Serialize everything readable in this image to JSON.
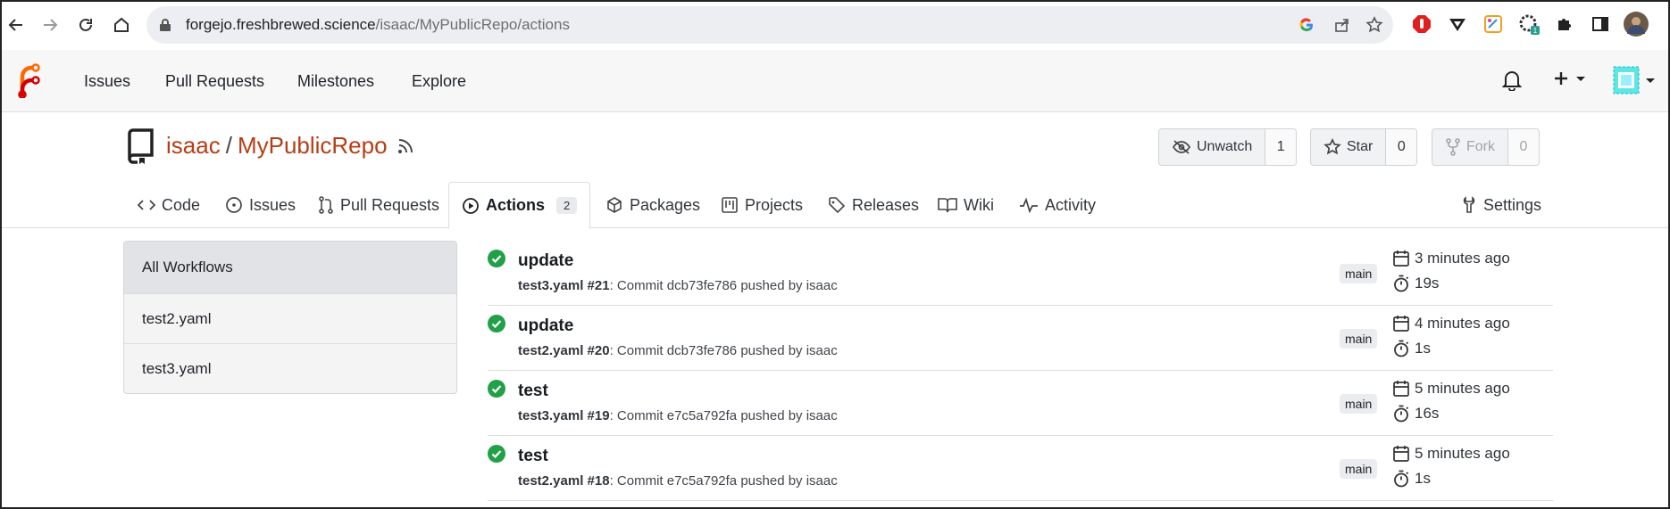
{
  "browser": {
    "url_host": "forgejo.freshbrewed.science",
    "url_path": "/isaac/MyPublicRepo/actions",
    "extension_badge": "1"
  },
  "topnav": {
    "items": [
      {
        "label": "Issues"
      },
      {
        "label": "Pull Requests"
      },
      {
        "label": "Milestones"
      },
      {
        "label": "Explore"
      }
    ]
  },
  "repo": {
    "owner": "isaac",
    "separator": "/",
    "name": "MyPublicRepo",
    "unwatch_label": "Unwatch",
    "watch_count": "1",
    "star_label": "Star",
    "star_count": "0",
    "fork_label": "Fork",
    "fork_count": "0"
  },
  "tabs": [
    {
      "label": "Code"
    },
    {
      "label": "Issues"
    },
    {
      "label": "Pull Requests"
    },
    {
      "label": "Actions",
      "badge": "2"
    },
    {
      "label": "Packages"
    },
    {
      "label": "Projects"
    },
    {
      "label": "Releases"
    },
    {
      "label": "Wiki"
    },
    {
      "label": "Activity"
    },
    {
      "label": "Settings"
    }
  ],
  "sidebar": {
    "items": [
      {
        "label": "All Workflows"
      },
      {
        "label": "test2.yaml"
      },
      {
        "label": "test3.yaml"
      }
    ]
  },
  "runs": [
    {
      "title": "update",
      "workflow": "test3.yaml #21",
      "detail": ": Commit dcb73fe786 pushed by isaac",
      "branch": "main",
      "when": "3 minutes ago",
      "duration": "19s"
    },
    {
      "title": "update",
      "workflow": "test2.yaml #20",
      "detail": ": Commit dcb73fe786 pushed by isaac",
      "branch": "main",
      "when": "4 minutes ago",
      "duration": "1s"
    },
    {
      "title": "test",
      "workflow": "test3.yaml #19",
      "detail": ": Commit e7c5a792fa pushed by isaac",
      "branch": "main",
      "when": "5 minutes ago",
      "duration": "16s"
    },
    {
      "title": "test",
      "workflow": "test2.yaml #18",
      "detail": ": Commit e7c5a792fa pushed by isaac",
      "branch": "main",
      "when": "5 minutes ago",
      "duration": "1s"
    }
  ],
  "colors": {
    "brand": "#b63e15",
    "success": "#21a047",
    "header_bg": "#f7f7f8"
  }
}
